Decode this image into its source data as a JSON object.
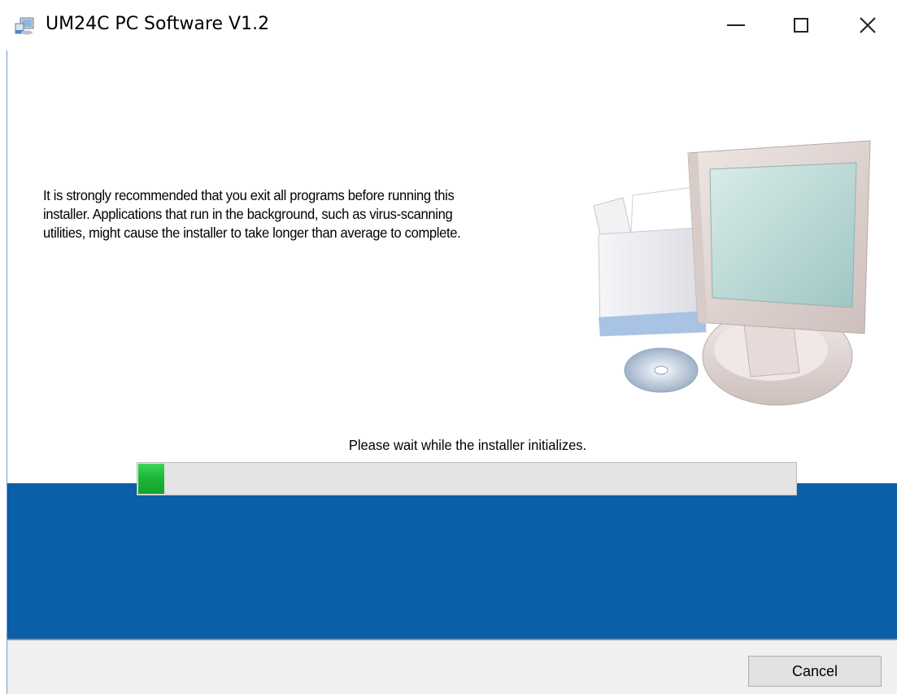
{
  "window": {
    "title": "UM24C PC Software V1.2",
    "controls": {
      "minimize_icon": "minimize-icon",
      "maximize_icon": "maximize-icon",
      "close_icon": "close-icon",
      "close_glyph": "✕"
    }
  },
  "main": {
    "intro_lines": [
      "It is strongly recommended that you exit all programs before running this",
      "installer. Applications that run in the background, such as virus-scanning",
      "utilities, might cause the installer to take longer than average to complete."
    ],
    "illustration_icon": "computer-with-disc-icon",
    "status": "Please wait while the installer initializes.",
    "progress_fraction": 0.04
  },
  "footer": {
    "cancel_label": "Cancel"
  },
  "colors": {
    "band": "#0a5fa6",
    "progress": "#1fb638",
    "track": "#e4e4e4"
  }
}
